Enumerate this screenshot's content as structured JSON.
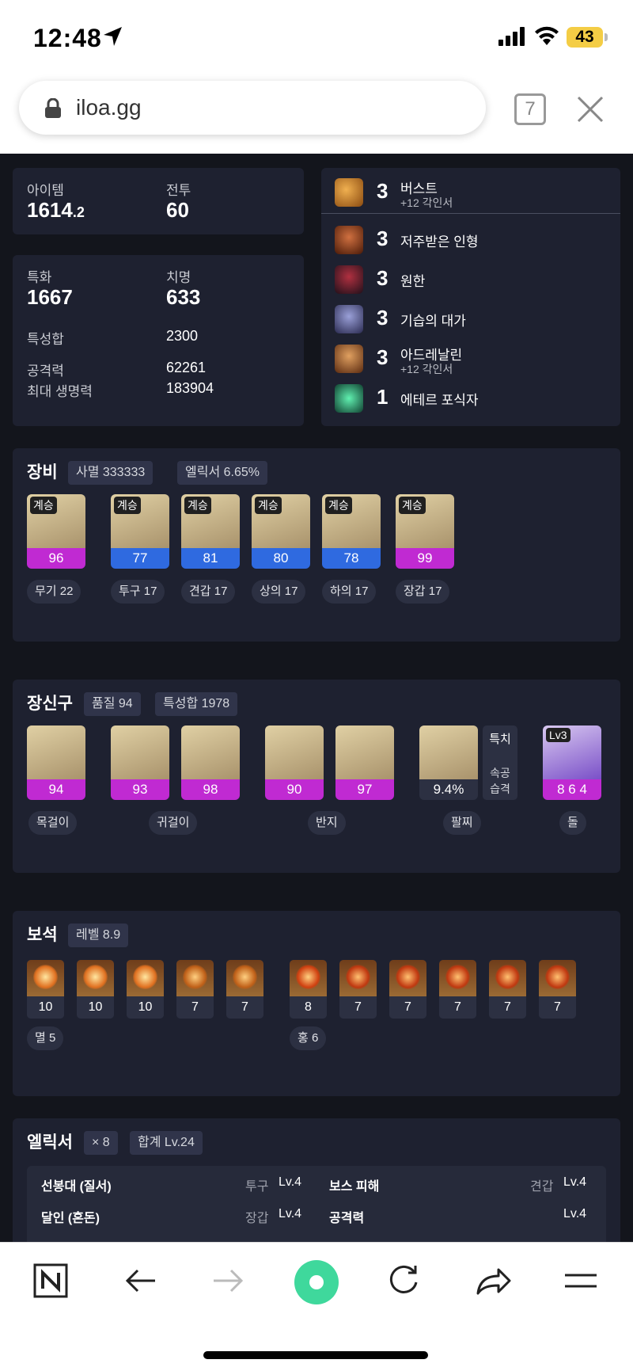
{
  "status_bar": {
    "time": "12:48",
    "battery": "43"
  },
  "browser": {
    "url": "iloa.gg",
    "tab_count": "7"
  },
  "stats": {
    "item_label": "아이템",
    "item_value": "1614",
    "item_decimal": ".2",
    "combat_label": "전투",
    "combat_value": "60",
    "spec_label": "특화",
    "spec_value": "1667",
    "crit_label": "치명",
    "crit_value": "633",
    "trait_sum_label": "특성합",
    "trait_sum_value": "2300",
    "attack_label": "공격력",
    "attack_value": "62261",
    "hp_label": "최대 생명력",
    "hp_value": "183904"
  },
  "engravings": [
    {
      "count": "3",
      "name": "버스트",
      "sub": "+12 각인서",
      "icon": "burst-engraving-icon"
    },
    {
      "count": "3",
      "name": "저주받은 인형",
      "sub": "",
      "icon": "cursed-doll-engraving-icon"
    },
    {
      "count": "3",
      "name": "원한",
      "sub": "",
      "icon": "grudge-engraving-icon"
    },
    {
      "count": "3",
      "name": "기습의 대가",
      "sub": "",
      "icon": "ambush-master-engraving-icon"
    },
    {
      "count": "3",
      "name": "아드레날린",
      "sub": "+12 각인서",
      "icon": "adrenaline-engraving-icon"
    },
    {
      "count": "1",
      "name": "에테르 포식자",
      "sub": "",
      "icon": "ether-predator-engraving-icon"
    }
  ],
  "equipment": {
    "title": "장비",
    "tag1": "사멸 333333",
    "tag2": "엘릭서 6.65%",
    "items": [
      {
        "badge": "계승",
        "quality": "96",
        "label": "무기 22",
        "color": "#c02ad2"
      },
      {
        "badge": "계승",
        "quality": "77",
        "label": "투구 17",
        "color": "#2f6ae0"
      },
      {
        "badge": "계승",
        "quality": "81",
        "label": "견갑 17",
        "color": "#2f6ae0"
      },
      {
        "badge": "계승",
        "quality": "80",
        "label": "상의 17",
        "color": "#2f6ae0"
      },
      {
        "badge": "계승",
        "quality": "78",
        "label": "하의 17",
        "color": "#2f6ae0"
      },
      {
        "badge": "계승",
        "quality": "99",
        "label": "장갑 17",
        "color": "#c02ad2"
      }
    ]
  },
  "accessories": {
    "title": "장신구",
    "tag1": "품질 94",
    "tag2": "특성합 1978",
    "items": [
      {
        "quality": "94",
        "icon": "necklace-icon"
      },
      {
        "quality": "93",
        "icon": "earring-icon"
      },
      {
        "quality": "98",
        "icon": "earring-icon"
      },
      {
        "quality": "90",
        "icon": "ring-icon"
      },
      {
        "quality": "97",
        "icon": "ring-icon"
      }
    ],
    "bracelet_value": "9.4%",
    "bracelet_stat": "특치",
    "bracelet_effect1": "속공",
    "bracelet_effect2": "습격",
    "stone_level": "Lv3",
    "stone_value": "8 6 4",
    "labels": {
      "necklace": "목걸이",
      "earring": "귀걸이",
      "ring": "반지",
      "bracelet": "팔찌",
      "stone": "돌"
    }
  },
  "gems": {
    "title": "보석",
    "tag": "레벨 8.9",
    "annihilation": [
      "10",
      "10",
      "10",
      "7",
      "7"
    ],
    "crimson": [
      "8",
      "7",
      "7",
      "7",
      "7",
      "7"
    ],
    "label_annihilation": "멸 5",
    "label_crimson": "홍 6"
  },
  "elixir": {
    "title": "엘릭서",
    "tag1": "× 8",
    "tag2": "합계 Lv.24",
    "rows": [
      {
        "name": "선봉대 (질서)",
        "slot": "투구",
        "level": "Lv.4",
        "name2": "보스 피해",
        "slot2": "견갑",
        "level2": "Lv.4"
      },
      {
        "name": "달인 (혼돈)",
        "slot": "장갑",
        "level": "Lv.4",
        "name2": "공격력",
        "slot2": "",
        "level2": "Lv.4"
      }
    ]
  },
  "colors": {
    "page_bg": "#13151c",
    "card_bg": "#1e2130",
    "relic_purple": "#c02ad2",
    "epic_blue": "#2f6ae0"
  }
}
